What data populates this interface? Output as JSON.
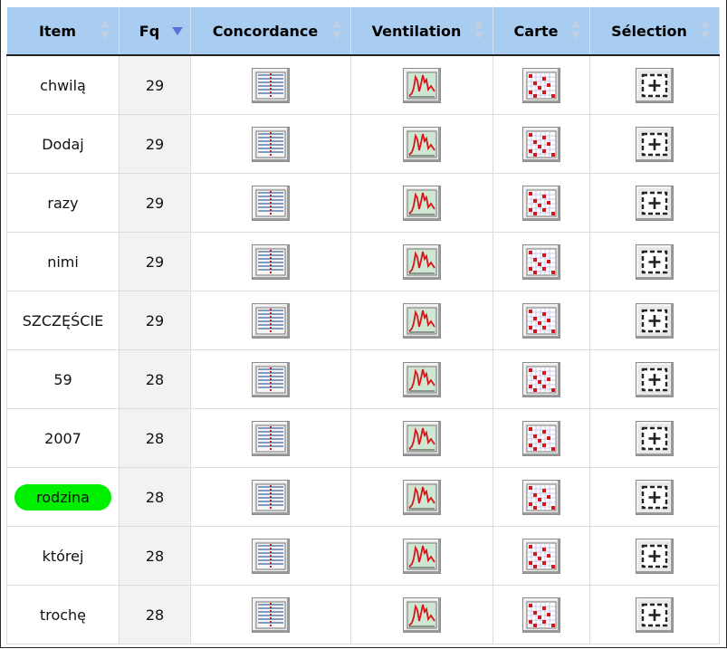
{
  "columns": {
    "item": "Item",
    "fq": "Fq",
    "concordance": "Concordance",
    "ventilation": "Ventilation",
    "carte": "Carte",
    "selection": "Sélection"
  },
  "sort": {
    "column": "Fq",
    "direction": "descending"
  },
  "highlight_color": "#00ee00",
  "header_color": "#a9cdf0",
  "rows": [
    {
      "item": "chwilą",
      "fq": "29",
      "highlighted": false
    },
    {
      "item": "Dodaj",
      "fq": "29",
      "highlighted": false
    },
    {
      "item": "razy",
      "fq": "29",
      "highlighted": false
    },
    {
      "item": "nimi",
      "fq": "29",
      "highlighted": false
    },
    {
      "item": "SZCZĘŚCIE",
      "fq": "29",
      "highlighted": false
    },
    {
      "item": "59",
      "fq": "28",
      "highlighted": false
    },
    {
      "item": "2007",
      "fq": "28",
      "highlighted": false
    },
    {
      "item": "rodzina",
      "fq": "28",
      "highlighted": true
    },
    {
      "item": "której",
      "fq": "28",
      "highlighted": false
    },
    {
      "item": "trochę",
      "fq": "28",
      "highlighted": false
    }
  ],
  "row_icons": {
    "concordance": "concordance-icon",
    "ventilation": "ventilation-icon",
    "carte": "map-icon",
    "selection": "add-selection-icon"
  }
}
